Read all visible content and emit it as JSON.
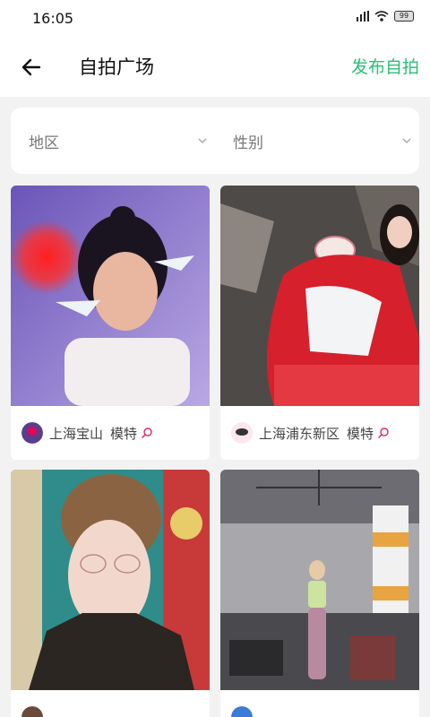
{
  "status_bar": {
    "time": "16:05",
    "battery": "99"
  },
  "header": {
    "title": "自拍广场",
    "publish_label": "发布自拍"
  },
  "filters": {
    "region_label": "地区",
    "gender_label": "性别"
  },
  "cards": [
    {
      "location": "上海宝山",
      "role": "模特"
    },
    {
      "location": "上海浦东新区",
      "role": "模特"
    },
    {
      "location": "",
      "role": ""
    },
    {
      "location": "",
      "role": ""
    }
  ],
  "colors": {
    "accent": "#2bbf74",
    "location_pin": "#e0245e"
  },
  "icons": [
    "back-arrow-icon",
    "chevron-down-icon",
    "location-pin-icon",
    "wifi-icon",
    "signal-icon",
    "battery-icon"
  ]
}
